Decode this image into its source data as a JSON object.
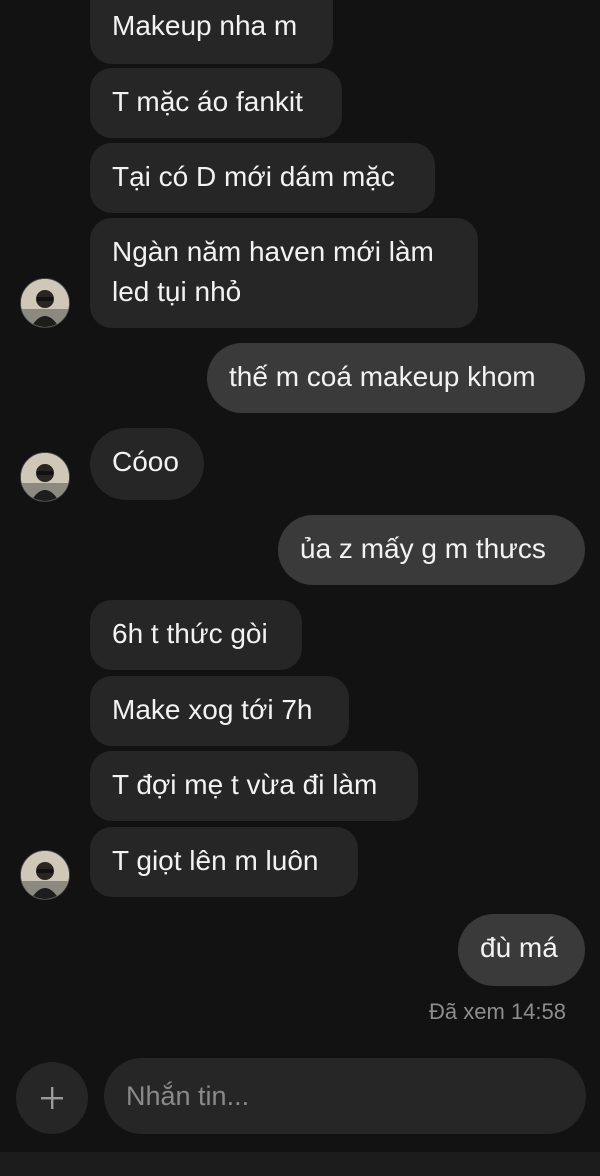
{
  "messages": [
    {
      "text": "Makeup nha m",
      "dir": "in"
    },
    {
      "text": "T mặc áo fankit",
      "dir": "in"
    },
    {
      "text": "Tại có D mới dám mặc",
      "dir": "in"
    },
    {
      "text": "Ngàn năm haven mới làm\nled tụi nhỏ",
      "dir": "in"
    },
    {
      "text": "thế m coá makeup khom",
      "dir": "out"
    },
    {
      "text": "Cóoo",
      "dir": "in"
    },
    {
      "text": "ủa z mấy g m thưcs",
      "dir": "out"
    },
    {
      "text": "6h t thức gòi",
      "dir": "in"
    },
    {
      "text": "Make xog tới 7h",
      "dir": "in"
    },
    {
      "text": "T đợi mẹ t vừa đi làm",
      "dir": "in"
    },
    {
      "text": "T giọt lên m luôn",
      "dir": "in"
    },
    {
      "text": "đù má",
      "dir": "out"
    }
  ],
  "seen_status": "Đã xem 14:58",
  "composer": {
    "placeholder": "Nhắn tin...",
    "add_icon": "plus-icon"
  },
  "colors": {
    "background": "#121212",
    "incoming_bubble": "#262626",
    "outgoing_bubble": "#3a3a3a"
  }
}
